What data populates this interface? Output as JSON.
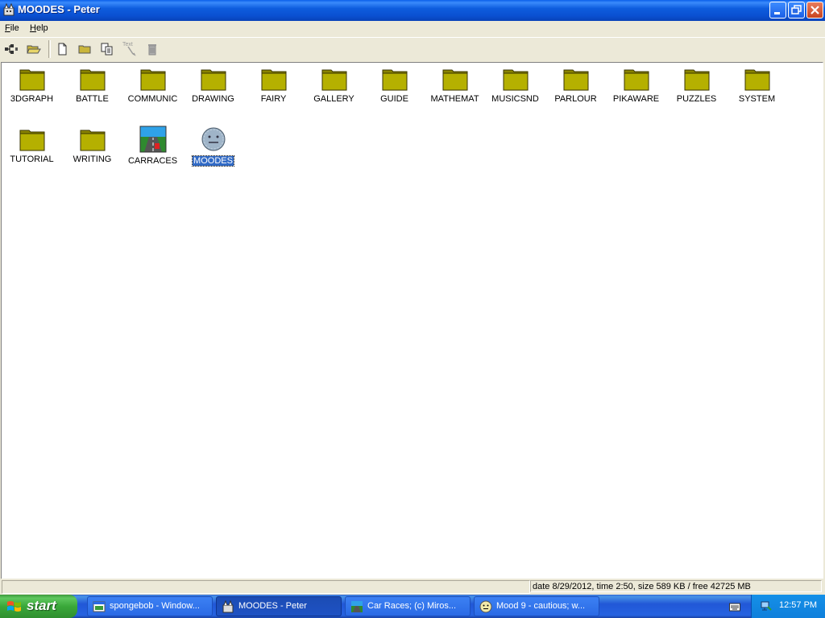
{
  "window": {
    "title": "MOODES - Peter"
  },
  "menu": {
    "file": {
      "underline": "F",
      "rest": "ile"
    },
    "help": {
      "underline": "H",
      "rest": "elp"
    }
  },
  "toolbar": {
    "tools": [
      "tree-icon",
      "open-folder-icon",
      "new-document-icon",
      "new-folder-icon",
      "copy-icon",
      "text-tool-icon",
      "trash-icon"
    ],
    "text_tool_label": "Text"
  },
  "items": [
    {
      "label": "3DGRAPH",
      "kind": "folder"
    },
    {
      "label": "BATTLE",
      "kind": "folder"
    },
    {
      "label": "COMMUNIC",
      "kind": "folder"
    },
    {
      "label": "DRAWING",
      "kind": "folder"
    },
    {
      "label": "FAIRY",
      "kind": "folder"
    },
    {
      "label": "GALLERY",
      "kind": "folder"
    },
    {
      "label": "GUIDE",
      "kind": "folder"
    },
    {
      "label": "MATHEMAT",
      "kind": "folder"
    },
    {
      "label": "MUSICSND",
      "kind": "folder"
    },
    {
      "label": "PARLOUR",
      "kind": "folder"
    },
    {
      "label": "PIKAWARE",
      "kind": "folder"
    },
    {
      "label": "PUZZLES",
      "kind": "folder"
    },
    {
      "label": "SYSTEM",
      "kind": "folder"
    },
    {
      "label": "TUTORIAL",
      "kind": "folder"
    },
    {
      "label": "WRITING",
      "kind": "folder"
    },
    {
      "label": "CARRACES",
      "kind": "program"
    },
    {
      "label": "MOODES",
      "kind": "program",
      "selected": true
    }
  ],
  "status": {
    "left": "",
    "right": "date 8/29/2012, time 2:50, size 589 KB / free 42725 MB"
  },
  "taskbar": {
    "start_label": "start",
    "tasks": [
      {
        "label": "spongebob - Window...",
        "icon": "window-icon"
      },
      {
        "label": "MOODES - Peter",
        "icon": "moodes-icon",
        "active": true
      },
      {
        "label": "Car Races;   (c) Miros...",
        "icon": "carraces-icon"
      },
      {
        "label": "Mood 9 - cautious;   w...",
        "icon": "smiley-icon"
      }
    ],
    "clock": "12:57 PM"
  },
  "colors": {
    "folder": "#B5B000",
    "selection": "#316AC5",
    "titlebar": "#0A50D2"
  }
}
